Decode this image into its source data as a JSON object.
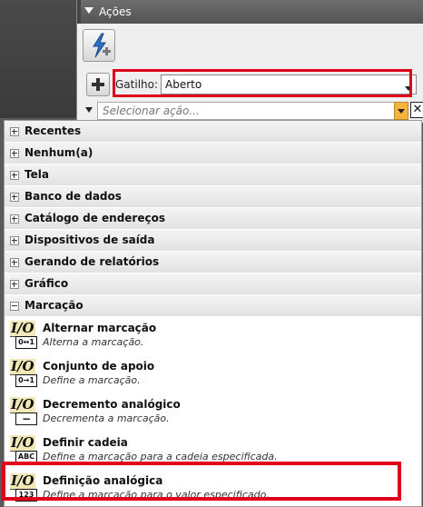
{
  "panel": {
    "title": "Ações"
  },
  "trigger": {
    "label": "Gatilho:",
    "value": "Aberto"
  },
  "action": {
    "placeholder": "Selecionar ação..."
  },
  "categories": [
    {
      "label": "Recentes",
      "expanded": false
    },
    {
      "label": "Nenhum(a)",
      "expanded": false
    },
    {
      "label": "Tela",
      "expanded": false
    },
    {
      "label": "Banco de dados",
      "expanded": false
    },
    {
      "label": "Catálogo de endereços",
      "expanded": false
    },
    {
      "label": "Dispositivos de saída",
      "expanded": false
    },
    {
      "label": "Gerando de relatórios",
      "expanded": false
    },
    {
      "label": "Gráfico",
      "expanded": false
    },
    {
      "label": "Marcação",
      "expanded": true
    }
  ],
  "items": [
    {
      "name": "Alternar marcação",
      "desc": "Alterna a marcação.",
      "icon": "io-toggle-icon",
      "badge": "0↔1"
    },
    {
      "name": "Conjunto de apoio",
      "desc": "Define a marcação.",
      "icon": "io-set-icon",
      "badge": "0→1"
    },
    {
      "name": "Decremento analógico",
      "desc": "Decrementa a marcação.",
      "icon": "io-decrement-icon",
      "badge": "−"
    },
    {
      "name": "Definir cadeia",
      "desc": "Define a marcação para a cadeia especificada.",
      "icon": "io-string-icon",
      "badge": "ABC"
    },
    {
      "name": "Definição analógica",
      "desc": "Define a marcação para o valor especificado.",
      "icon": "io-analog-icon",
      "badge": "123"
    }
  ],
  "icon_io_text": "I/O",
  "colors": {
    "highlight": "#e0001b",
    "dropdown_button": "#f5b53c",
    "header": "#5e5e5e"
  }
}
